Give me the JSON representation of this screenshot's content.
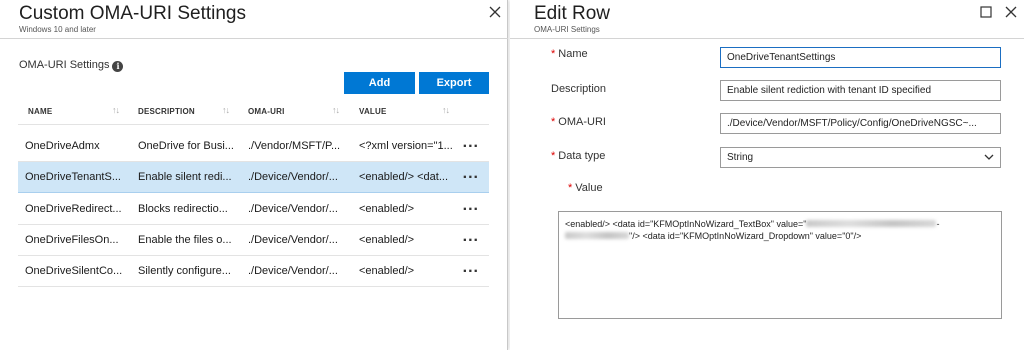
{
  "left_blade": {
    "title": "Custom OMA-URI Settings",
    "subtitle": "Windows 10 and later",
    "section_label": "OMA-URI Settings",
    "add_label": "Add",
    "export_label": "Export",
    "columns": [
      "NAME",
      "DESCRIPTION",
      "OMA-URI",
      "VALUE"
    ],
    "rows": [
      {
        "name": "OneDriveAdmx",
        "description": "OneDrive for Busi...",
        "uri": "./Vendor/MSFT/P...",
        "value": "<?xml version=\"1..."
      },
      {
        "name": "OneDriveTenantS...",
        "description": "Enable silent redi...",
        "uri": "./Device/Vendor/...",
        "value": "<enabled/> <dat..."
      },
      {
        "name": "OneDriveRedirect...",
        "description": "Blocks redirectio...",
        "uri": "./Device/Vendor/...",
        "value": "<enabled/>"
      },
      {
        "name": "OneDriveFilesOn...",
        "description": "Enable the files o...",
        "uri": "./Device/Vendor/...",
        "value": "<enabled/>"
      },
      {
        "name": "OneDriveSilentCo...",
        "description": "Silently configure...",
        "uri": "./Device/Vendor/...",
        "value": "<enabled/>"
      }
    ],
    "more_label": "..."
  },
  "right_blade": {
    "title": "Edit Row",
    "subtitle": "OMA-URI Settings",
    "name_label": "Name",
    "name_value": "OneDriveTenantSettings",
    "description_label": "Description",
    "description_value": "Enable silent rediction with tenant ID specified",
    "uri_label": "OMA-URI",
    "uri_value": "./Device/Vendor/MSFT/Policy/Config/OneDriveNGSC~...",
    "datatype_label": "Data type",
    "datatype_value": "String",
    "value_label": "Value",
    "value_text_1": "<enabled/> <data id=\"KFMOptInNoWizard_TextBox\" value=\"",
    "value_text_2": "-",
    "value_text_3": "\"/> <data id=\"KFMOptInNoWizard_Dropdown\" value=\"0\"/>"
  },
  "colors": {
    "accent": "#0078d4",
    "selected_row": "#cfe6f7",
    "required": "#d00000"
  },
  "icons": [
    "close-icon",
    "maximize-icon",
    "info-icon",
    "sort-icon",
    "chevron-down-icon",
    "more-icon"
  ]
}
